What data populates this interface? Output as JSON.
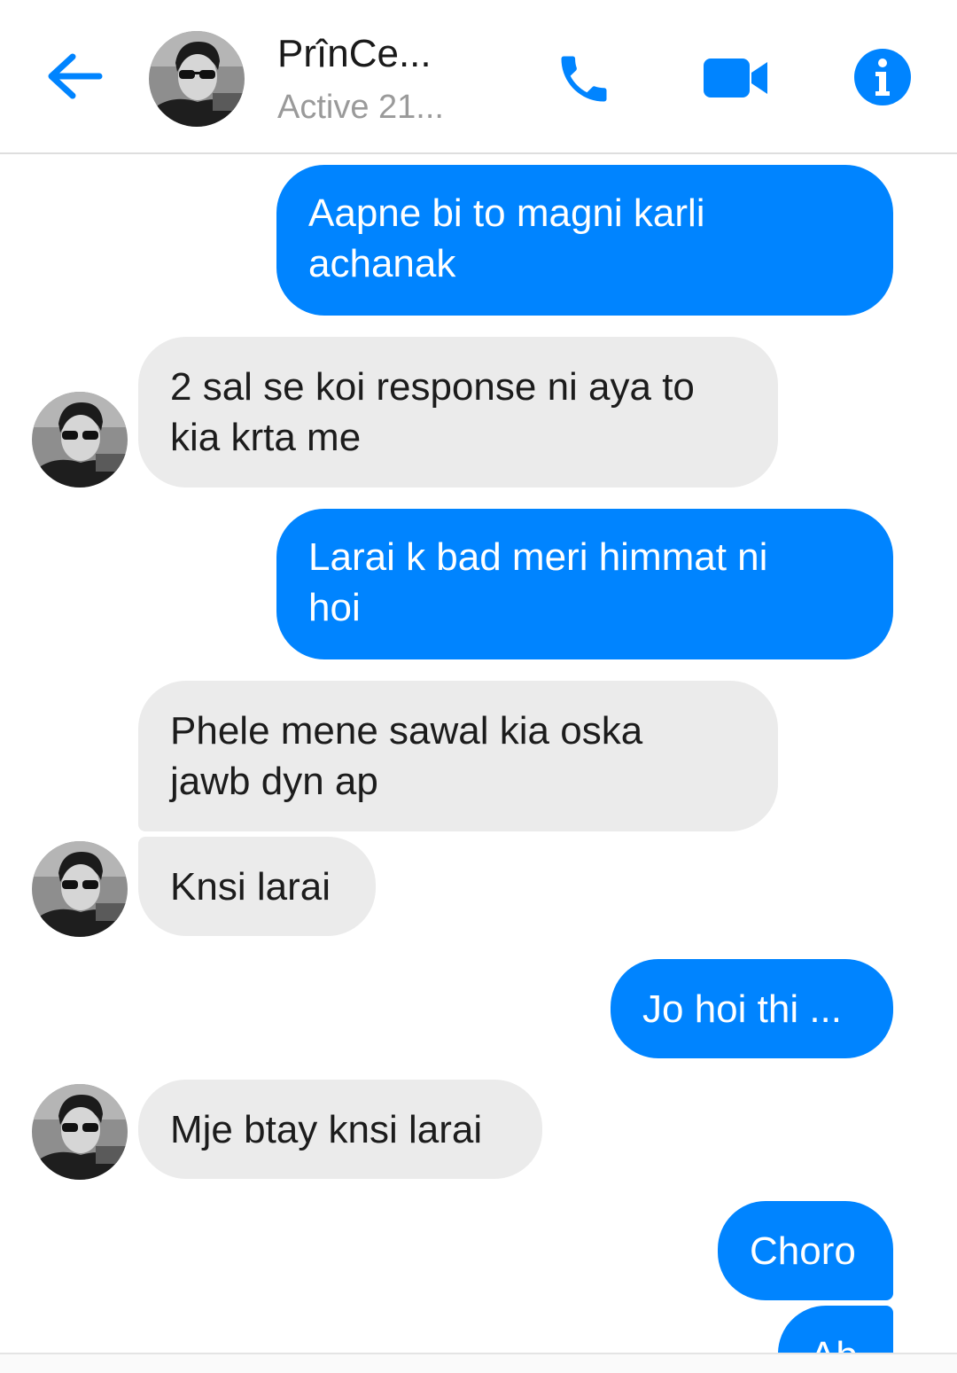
{
  "header": {
    "contact_name": "PrînCe...",
    "status": "Active 21...",
    "icons": [
      "back-arrow-icon",
      "phone-icon",
      "video-camera-icon",
      "info-icon"
    ],
    "accent_color": "#0084ff"
  },
  "messages": [
    {
      "direction": "outgoing",
      "lines": [
        "Aapne bi to magni karli",
        "achanak"
      ]
    },
    {
      "direction": "incoming",
      "lines": [
        "2 sal se koi response ni aya to",
        "kia krta me"
      ]
    },
    {
      "direction": "outgoing",
      "lines": [
        "Larai k bad meri himmat ni",
        "hoi"
      ]
    },
    {
      "direction": "incoming",
      "lines": [
        "Phele mene sawal kia oska",
        "jawb dyn ap"
      ]
    },
    {
      "direction": "incoming",
      "lines": [
        "Knsi larai"
      ]
    },
    {
      "direction": "outgoing",
      "lines": [
        "Jo hoi thi ..."
      ]
    },
    {
      "direction": "incoming",
      "lines": [
        "Mje btay knsi larai"
      ]
    },
    {
      "direction": "outgoing",
      "lines": [
        "Choro"
      ]
    },
    {
      "direction": "outgoing",
      "lines": [
        "Ab"
      ]
    }
  ]
}
